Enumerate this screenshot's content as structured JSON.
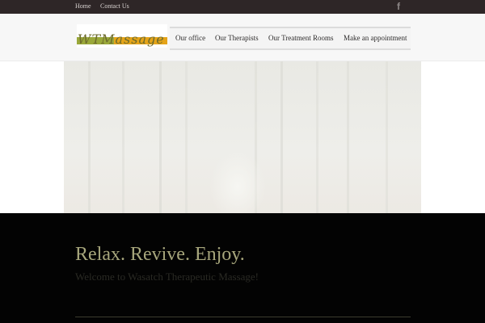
{
  "topbar": {
    "links": [
      "Home",
      "Contact Us"
    ],
    "social_icon": "facebook-icon",
    "social_glyph": "f"
  },
  "header": {
    "logo_text": "WTMassage",
    "nav": [
      "Our office",
      "Our Therapists",
      "Our Treatment Rooms",
      "Make an appointment"
    ]
  },
  "hero": {
    "image": "bamboo-forest"
  },
  "intro": {
    "tagline": "Relax. Revive. Enjoy.",
    "welcome": "Welcome to Wasatch Therapeutic Massage!"
  },
  "colors": {
    "topbar": "#2e2627",
    "band": "#030303",
    "tagline": "#a7a67c",
    "logo_green": "#9aa83a",
    "logo_orange": "#e5a419"
  }
}
